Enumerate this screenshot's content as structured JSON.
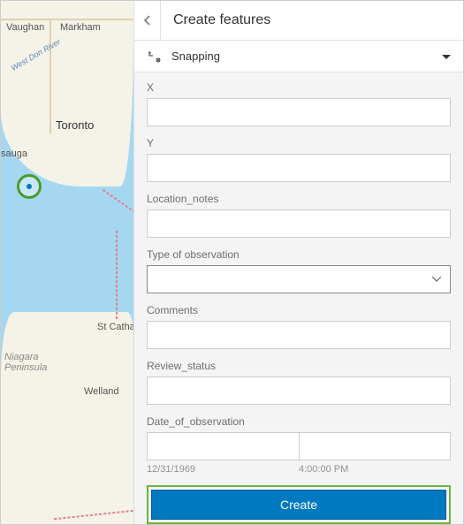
{
  "map": {
    "labels": {
      "vaughan": "Vaughan",
      "markham": "Markham",
      "toronto": "Toronto",
      "sauga": "sauga",
      "stcath": "St Catharii",
      "niagara": "Niagara\nPeninsula",
      "welland": "Welland",
      "river": "West Don River"
    }
  },
  "panel": {
    "title": "Create features",
    "snapping": "Snapping",
    "fields": {
      "x": {
        "label": "X",
        "value": ""
      },
      "y": {
        "label": "Y",
        "value": ""
      },
      "location_notes": {
        "label": "Location_notes",
        "value": ""
      },
      "obs_type": {
        "label": "Type of observation",
        "value": ""
      },
      "comments": {
        "label": "Comments",
        "value": ""
      },
      "review_status": {
        "label": "Review_status",
        "value": ""
      },
      "date_obs": {
        "label": "Date_of_observation",
        "date": "",
        "time": "",
        "date_hint": "12/31/1969",
        "time_hint": "4:00:00 PM"
      }
    },
    "create": "Create"
  }
}
